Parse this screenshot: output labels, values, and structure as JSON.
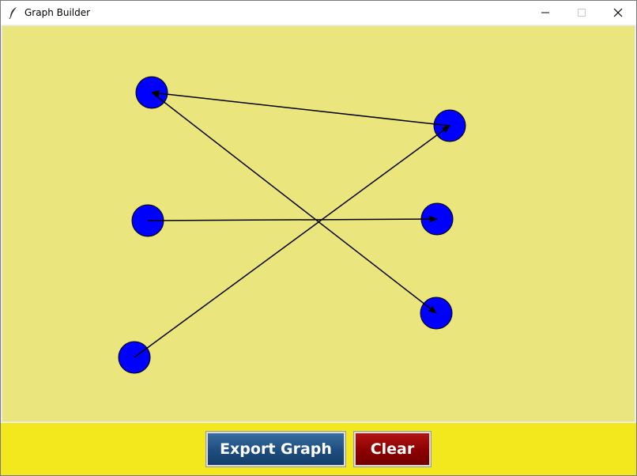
{
  "window": {
    "title": "Graph Builder",
    "icon": "feather-icon"
  },
  "titlebar_buttons": {
    "minimize": "minimize-icon",
    "maximize": "maximize-icon",
    "close": "close-icon"
  },
  "canvas": {
    "background": "#ebe57e",
    "node_color": "#0000ff",
    "edge_color": "#000000"
  },
  "toolbar": {
    "background": "#f3e81e",
    "export_label": "Export Graph",
    "clear_label": "Clear"
  }
}
